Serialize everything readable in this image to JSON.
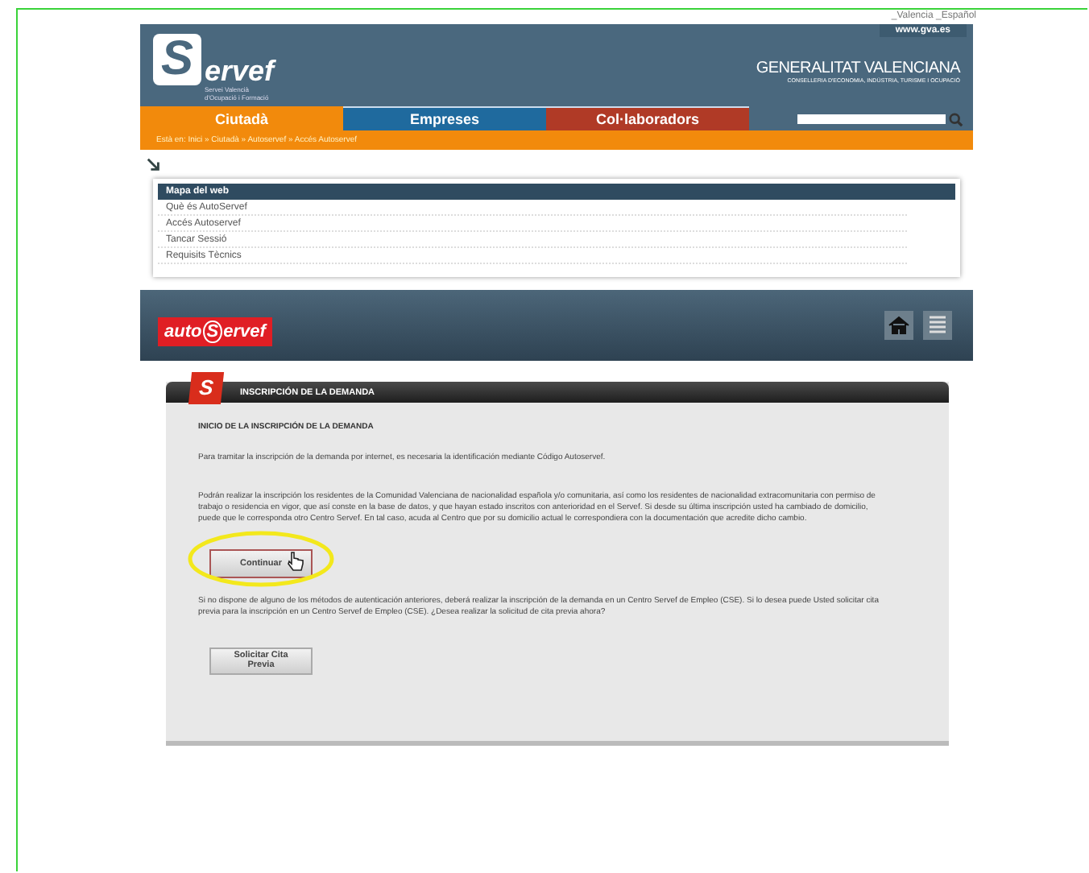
{
  "language_links": "_Valencia _Español",
  "header": {
    "site_link": "www.gva.es",
    "logo_letter": "S",
    "logo_rest": "ervef",
    "logo_subtitle": "Servei Valencià d'Ocupació i Formació",
    "government": "GENERALITAT VALENCIANA",
    "department": "CONSELLERIA D'ECONOMIA, INDÚSTRIA, TURISME I OCUPACIÓ"
  },
  "tabs": [
    {
      "label": "Ciutadà",
      "selected": true,
      "color": "#f28a0c"
    },
    {
      "label": "Empreses",
      "selected": false,
      "color": "#1f6a9e"
    },
    {
      "label": "Col·laboradors",
      "selected": false,
      "color": "#b03a26"
    }
  ],
  "breadcrumb": "Està en: Inici » Ciutadà » Autoservef » Accés Autoservef",
  "site_map": {
    "title": "Mapa del web",
    "items": [
      "Què és AutoServef",
      "Accés Autoservef",
      "Tancar Sessió",
      "Requisits Tècnics"
    ]
  },
  "auto_banner": {
    "logo_start": "auto",
    "logo_letter": "S",
    "logo_rest": "ervef"
  },
  "form": {
    "badge": "S",
    "title": "INSCRIPCIÓN DE LA DEMANDA",
    "heading": "INICIO DE LA INSCRIPCIÓN DE LA DEMANDA",
    "paragraphs": [
      "Para tramitar la inscripción de la demanda por internet, es necesaria la identificación mediante Código Autoservef.",
      "Podrán realizar la inscripción los residentes de la Comunidad Valenciana de nacionalidad española y/o comunitaria, así como los residentes de nacionalidad extracomunitaria con permiso de trabajo o residencia en vigor, que así conste en la base de datos, y que hayan estado inscritos con anterioridad en el Servef. Si desde su última inscripción usted ha cambiado de domicilio, puede que le corresponda otro Centro Servef. En tal caso, acuda al Centro que por su domicilio actual le correspondiera con la documentación que acredite dicho cambio."
    ],
    "continue_button": "Continuar",
    "note": "Si no dispone de alguno de los métodos de autenticación anteriores, deberá realizar la inscripción de la demanda en un Centro Servef de Empleo (CSE). Si lo desea puede Usted solicitar cita previa para la inscripción en un Centro Servef de Empleo (CSE). ¿Desea realizar la solicitud de cita previa ahora?",
    "appointment_button": "Solicitar Cita Previa"
  }
}
